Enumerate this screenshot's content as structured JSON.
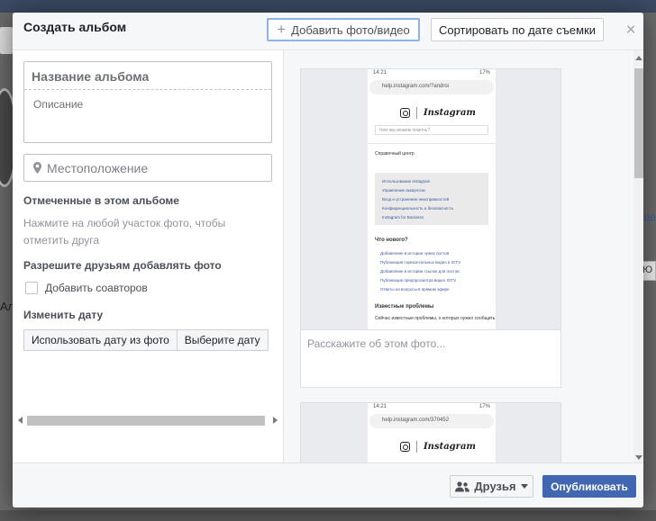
{
  "dialog": {
    "title": "Создать альбом",
    "add_button": "Добавить фото/видео",
    "sort_button": "Сортировать по дате съемки",
    "close_icon": "close-icon"
  },
  "form": {
    "album_name_placeholder": "Название альбома",
    "description_placeholder": "Описание",
    "location_placeholder": "Местоположение",
    "tagged_title": "Отмеченные в этом альбоме",
    "tagged_hint": "Нажмите на любой участок фото, чтобы отметить друга",
    "friends_title": "Разрешите друзьям добавлять фото",
    "coauthors_label": "Добавить соавторов",
    "coauthors_checked": false,
    "date_title": "Изменить дату",
    "date_from_photo": "Использовать дату из фото",
    "date_choose": "Выберите дату"
  },
  "photos": [
    {
      "caption_placeholder": "Расскажите об этом фото...",
      "phone": {
        "time": "14:21",
        "battery": "17%",
        "url": "help.instagram.com/?androi",
        "brand": "Instagram",
        "search_placeholder": "Чем мы можем помочь?",
        "help_center": "Справочный центр",
        "links": [
          "Использование Instagram",
          "Управление аккаунтом",
          "Вход и устранение неисправностей",
          "Конфиденциальность и безопасность",
          "Instagram for Business"
        ],
        "whats_new": "Что нового?",
        "news": [
          "Добавление в истории чужих постов",
          "Публикация горизонтальных видео в IGTV",
          "Добавление в истории ссылок для постов",
          "Публикация предпросмотра видео IGTV",
          "Ответы на вопросы в прямом эфире"
        ],
        "known_issues": "Известные проблемы",
        "known_issues_text": "Сейчас известные проблемы, о которых нужно сообщить"
      }
    },
    {
      "phone": {
        "time": "14:21",
        "battery": "17%",
        "url": "help.instagram.com/370452",
        "brand": "Instagram"
      }
    }
  ],
  "footer": {
    "audience": "Друзья",
    "publish": "Опубликовать"
  },
  "background": {
    "left_text": "Ал",
    "right_text": "це",
    "right_box_text": "Ю"
  },
  "colors": {
    "primary": "#4267b2",
    "link": "#3b5998"
  }
}
